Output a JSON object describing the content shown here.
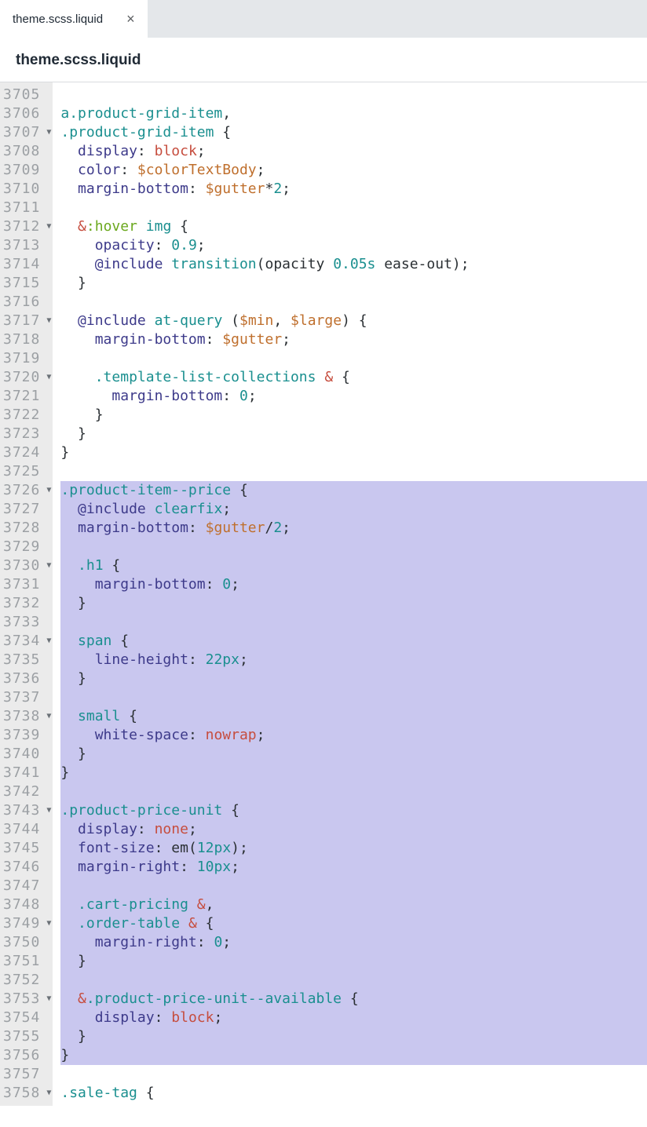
{
  "tab": {
    "label": "theme.scss.liquid",
    "close": "×"
  },
  "filename": "theme.scss.liquid",
  "firstLine": 3705,
  "lines": [
    {
      "fold": false,
      "sel": false,
      "tokens": []
    },
    {
      "fold": false,
      "sel": false,
      "tokens": [
        {
          "t": "a",
          "c": "c-sel"
        },
        {
          "t": ".product-grid-item",
          "c": "c-sel"
        },
        {
          "t": ",",
          "c": "c-plain"
        }
      ]
    },
    {
      "fold": true,
      "sel": false,
      "tokens": [
        {
          "t": ".product-grid-item",
          "c": "c-sel"
        },
        {
          "t": " {",
          "c": "c-plain"
        }
      ]
    },
    {
      "fold": false,
      "sel": false,
      "tokens": [
        {
          "t": "  ",
          "c": ""
        },
        {
          "t": "display",
          "c": "c-prop"
        },
        {
          "t": ": ",
          "c": "c-plain"
        },
        {
          "t": "block",
          "c": "c-val"
        },
        {
          "t": ";",
          "c": "c-plain"
        }
      ]
    },
    {
      "fold": false,
      "sel": false,
      "tokens": [
        {
          "t": "  ",
          "c": ""
        },
        {
          "t": "color",
          "c": "c-prop"
        },
        {
          "t": ": ",
          "c": "c-plain"
        },
        {
          "t": "$colorTextBody",
          "c": "c-var"
        },
        {
          "t": ";",
          "c": "c-plain"
        }
      ]
    },
    {
      "fold": false,
      "sel": false,
      "tokens": [
        {
          "t": "  ",
          "c": ""
        },
        {
          "t": "margin-bottom",
          "c": "c-prop"
        },
        {
          "t": ": ",
          "c": "c-plain"
        },
        {
          "t": "$gutter",
          "c": "c-var"
        },
        {
          "t": "*",
          "c": "c-plain"
        },
        {
          "t": "2",
          "c": "c-num"
        },
        {
          "t": ";",
          "c": "c-plain"
        }
      ]
    },
    {
      "fold": false,
      "sel": false,
      "tokens": []
    },
    {
      "fold": true,
      "sel": false,
      "tokens": [
        {
          "t": "  ",
          "c": ""
        },
        {
          "t": "&",
          "c": "c-amp"
        },
        {
          "t": ":",
          "c": "c-pse"
        },
        {
          "t": "hover",
          "c": "c-pse"
        },
        {
          "t": " ",
          "c": ""
        },
        {
          "t": "img",
          "c": "c-sel"
        },
        {
          "t": " {",
          "c": "c-plain"
        }
      ]
    },
    {
      "fold": false,
      "sel": false,
      "tokens": [
        {
          "t": "    ",
          "c": ""
        },
        {
          "t": "opacity",
          "c": "c-prop"
        },
        {
          "t": ": ",
          "c": "c-plain"
        },
        {
          "t": "0.9",
          "c": "c-num"
        },
        {
          "t": ";",
          "c": "c-plain"
        }
      ]
    },
    {
      "fold": false,
      "sel": false,
      "tokens": [
        {
          "t": "    ",
          "c": ""
        },
        {
          "t": "@include",
          "c": "c-at"
        },
        {
          "t": " ",
          "c": ""
        },
        {
          "t": "transition",
          "c": "c-key"
        },
        {
          "t": "(",
          "c": "c-plain"
        },
        {
          "t": "opacity ",
          "c": "c-plain"
        },
        {
          "t": "0.05s",
          "c": "c-num"
        },
        {
          "t": " ease-out",
          "c": "c-plain"
        },
        {
          "t": ")",
          "c": "c-plain"
        },
        {
          "t": ";",
          "c": "c-plain"
        }
      ]
    },
    {
      "fold": false,
      "sel": false,
      "tokens": [
        {
          "t": "  }",
          "c": "c-plain"
        }
      ]
    },
    {
      "fold": false,
      "sel": false,
      "tokens": []
    },
    {
      "fold": true,
      "sel": false,
      "tokens": [
        {
          "t": "  ",
          "c": ""
        },
        {
          "t": "@include",
          "c": "c-at"
        },
        {
          "t": " ",
          "c": ""
        },
        {
          "t": "at-query",
          "c": "c-key"
        },
        {
          "t": " (",
          "c": "c-plain"
        },
        {
          "t": "$min",
          "c": "c-var"
        },
        {
          "t": ", ",
          "c": "c-plain"
        },
        {
          "t": "$large",
          "c": "c-var"
        },
        {
          "t": ")",
          "c": "c-plain"
        },
        {
          "t": " {",
          "c": "c-plain"
        }
      ]
    },
    {
      "fold": false,
      "sel": false,
      "tokens": [
        {
          "t": "    ",
          "c": ""
        },
        {
          "t": "margin-bottom",
          "c": "c-prop"
        },
        {
          "t": ": ",
          "c": "c-plain"
        },
        {
          "t": "$gutter",
          "c": "c-var"
        },
        {
          "t": ";",
          "c": "c-plain"
        }
      ]
    },
    {
      "fold": false,
      "sel": false,
      "tokens": []
    },
    {
      "fold": true,
      "sel": false,
      "tokens": [
        {
          "t": "    ",
          "c": ""
        },
        {
          "t": ".template-list-collections",
          "c": "c-sel"
        },
        {
          "t": " ",
          "c": ""
        },
        {
          "t": "&",
          "c": "c-amp"
        },
        {
          "t": " {",
          "c": "c-plain"
        }
      ]
    },
    {
      "fold": false,
      "sel": false,
      "tokens": [
        {
          "t": "      ",
          "c": ""
        },
        {
          "t": "margin-bottom",
          "c": "c-prop"
        },
        {
          "t": ": ",
          "c": "c-plain"
        },
        {
          "t": "0",
          "c": "c-num"
        },
        {
          "t": ";",
          "c": "c-plain"
        }
      ]
    },
    {
      "fold": false,
      "sel": false,
      "tokens": [
        {
          "t": "    }",
          "c": "c-plain"
        }
      ]
    },
    {
      "fold": false,
      "sel": false,
      "tokens": [
        {
          "t": "  }",
          "c": "c-plain"
        }
      ]
    },
    {
      "fold": false,
      "sel": false,
      "tokens": [
        {
          "t": "}",
          "c": "c-plain"
        }
      ]
    },
    {
      "fold": false,
      "sel": false,
      "tokens": []
    },
    {
      "fold": true,
      "sel": true,
      "tokens": [
        {
          "t": ".product-item--price",
          "c": "c-sel"
        },
        {
          "t": " {",
          "c": "c-plain"
        }
      ]
    },
    {
      "fold": false,
      "sel": true,
      "tokens": [
        {
          "t": "  ",
          "c": ""
        },
        {
          "t": "@include",
          "c": "c-at"
        },
        {
          "t": " ",
          "c": ""
        },
        {
          "t": "clearfix",
          "c": "c-key"
        },
        {
          "t": ";",
          "c": "c-plain"
        }
      ]
    },
    {
      "fold": false,
      "sel": true,
      "tokens": [
        {
          "t": "  ",
          "c": ""
        },
        {
          "t": "margin-bottom",
          "c": "c-prop"
        },
        {
          "t": ": ",
          "c": "c-plain"
        },
        {
          "t": "$gutter",
          "c": "c-var"
        },
        {
          "t": "/",
          "c": "c-plain"
        },
        {
          "t": "2",
          "c": "c-num"
        },
        {
          "t": ";",
          "c": "c-plain"
        }
      ]
    },
    {
      "fold": false,
      "sel": true,
      "tokens": []
    },
    {
      "fold": true,
      "sel": true,
      "tokens": [
        {
          "t": "  ",
          "c": ""
        },
        {
          "t": ".h1",
          "c": "c-sel"
        },
        {
          "t": " {",
          "c": "c-plain"
        }
      ]
    },
    {
      "fold": false,
      "sel": true,
      "tokens": [
        {
          "t": "    ",
          "c": ""
        },
        {
          "t": "margin-bottom",
          "c": "c-prop"
        },
        {
          "t": ": ",
          "c": "c-plain"
        },
        {
          "t": "0",
          "c": "c-num"
        },
        {
          "t": ";",
          "c": "c-plain"
        }
      ]
    },
    {
      "fold": false,
      "sel": true,
      "tokens": [
        {
          "t": "  }",
          "c": "c-plain"
        }
      ]
    },
    {
      "fold": false,
      "sel": true,
      "tokens": []
    },
    {
      "fold": true,
      "sel": true,
      "tokens": [
        {
          "t": "  ",
          "c": ""
        },
        {
          "t": "span",
          "c": "c-sel"
        },
        {
          "t": " {",
          "c": "c-plain"
        }
      ]
    },
    {
      "fold": false,
      "sel": true,
      "tokens": [
        {
          "t": "    ",
          "c": ""
        },
        {
          "t": "line-height",
          "c": "c-prop"
        },
        {
          "t": ": ",
          "c": "c-plain"
        },
        {
          "t": "22px",
          "c": "c-num"
        },
        {
          "t": ";",
          "c": "c-plain"
        }
      ]
    },
    {
      "fold": false,
      "sel": true,
      "tokens": [
        {
          "t": "  }",
          "c": "c-plain"
        }
      ]
    },
    {
      "fold": false,
      "sel": true,
      "tokens": []
    },
    {
      "fold": true,
      "sel": true,
      "tokens": [
        {
          "t": "  ",
          "c": ""
        },
        {
          "t": "small",
          "c": "c-sel"
        },
        {
          "t": " {",
          "c": "c-plain"
        }
      ]
    },
    {
      "fold": false,
      "sel": true,
      "tokens": [
        {
          "t": "    ",
          "c": ""
        },
        {
          "t": "white-space",
          "c": "c-prop"
        },
        {
          "t": ": ",
          "c": "c-plain"
        },
        {
          "t": "nowrap",
          "c": "c-val"
        },
        {
          "t": ";",
          "c": "c-plain"
        }
      ]
    },
    {
      "fold": false,
      "sel": true,
      "tokens": [
        {
          "t": "  }",
          "c": "c-plain"
        }
      ]
    },
    {
      "fold": false,
      "sel": true,
      "tokens": [
        {
          "t": "}",
          "c": "c-plain"
        }
      ]
    },
    {
      "fold": false,
      "sel": true,
      "tokens": []
    },
    {
      "fold": true,
      "sel": true,
      "tokens": [
        {
          "t": ".product-price-unit",
          "c": "c-sel"
        },
        {
          "t": " {",
          "c": "c-plain"
        }
      ]
    },
    {
      "fold": false,
      "sel": true,
      "tokens": [
        {
          "t": "  ",
          "c": ""
        },
        {
          "t": "display",
          "c": "c-prop"
        },
        {
          "t": ": ",
          "c": "c-plain"
        },
        {
          "t": "none",
          "c": "c-val"
        },
        {
          "t": ";",
          "c": "c-plain"
        }
      ]
    },
    {
      "fold": false,
      "sel": true,
      "tokens": [
        {
          "t": "  ",
          "c": ""
        },
        {
          "t": "font-size",
          "c": "c-prop"
        },
        {
          "t": ": ",
          "c": "c-plain"
        },
        {
          "t": "em",
          "c": "c-plain"
        },
        {
          "t": "(",
          "c": "c-plain"
        },
        {
          "t": "12px",
          "c": "c-num"
        },
        {
          "t": ")",
          "c": "c-plain"
        },
        {
          "t": ";",
          "c": "c-plain"
        }
      ]
    },
    {
      "fold": false,
      "sel": true,
      "tokens": [
        {
          "t": "  ",
          "c": ""
        },
        {
          "t": "margin-right",
          "c": "c-prop"
        },
        {
          "t": ": ",
          "c": "c-plain"
        },
        {
          "t": "10px",
          "c": "c-num"
        },
        {
          "t": ";",
          "c": "c-plain"
        }
      ]
    },
    {
      "fold": false,
      "sel": true,
      "tokens": []
    },
    {
      "fold": false,
      "sel": true,
      "tokens": [
        {
          "t": "  ",
          "c": ""
        },
        {
          "t": ".cart-pricing",
          "c": "c-sel"
        },
        {
          "t": " ",
          "c": ""
        },
        {
          "t": "&",
          "c": "c-amp"
        },
        {
          "t": ",",
          "c": "c-plain"
        }
      ]
    },
    {
      "fold": true,
      "sel": true,
      "tokens": [
        {
          "t": "  ",
          "c": ""
        },
        {
          "t": ".order-table",
          "c": "c-sel"
        },
        {
          "t": " ",
          "c": ""
        },
        {
          "t": "&",
          "c": "c-amp"
        },
        {
          "t": " {",
          "c": "c-plain"
        }
      ]
    },
    {
      "fold": false,
      "sel": true,
      "tokens": [
        {
          "t": "    ",
          "c": ""
        },
        {
          "t": "margin-right",
          "c": "c-prop"
        },
        {
          "t": ": ",
          "c": "c-plain"
        },
        {
          "t": "0",
          "c": "c-num"
        },
        {
          "t": ";",
          "c": "c-plain"
        }
      ]
    },
    {
      "fold": false,
      "sel": true,
      "tokens": [
        {
          "t": "  }",
          "c": "c-plain"
        }
      ]
    },
    {
      "fold": false,
      "sel": true,
      "tokens": []
    },
    {
      "fold": true,
      "sel": true,
      "tokens": [
        {
          "t": "  ",
          "c": ""
        },
        {
          "t": "&",
          "c": "c-amp"
        },
        {
          "t": ".product-price-unit--available",
          "c": "c-sel"
        },
        {
          "t": " {",
          "c": "c-plain"
        }
      ]
    },
    {
      "fold": false,
      "sel": true,
      "tokens": [
        {
          "t": "    ",
          "c": ""
        },
        {
          "t": "display",
          "c": "c-prop"
        },
        {
          "t": ": ",
          "c": "c-plain"
        },
        {
          "t": "block",
          "c": "c-val"
        },
        {
          "t": ";",
          "c": "c-plain"
        }
      ]
    },
    {
      "fold": false,
      "sel": true,
      "tokens": [
        {
          "t": "  }",
          "c": "c-plain"
        }
      ]
    },
    {
      "fold": false,
      "sel": true,
      "tokens": [
        {
          "t": "}",
          "c": "c-plain"
        }
      ]
    },
    {
      "fold": false,
      "sel": false,
      "tokens": []
    },
    {
      "fold": true,
      "sel": false,
      "tokens": [
        {
          "t": ".sale-tag",
          "c": "c-sel"
        },
        {
          "t": " {",
          "c": "c-plain"
        }
      ]
    }
  ]
}
